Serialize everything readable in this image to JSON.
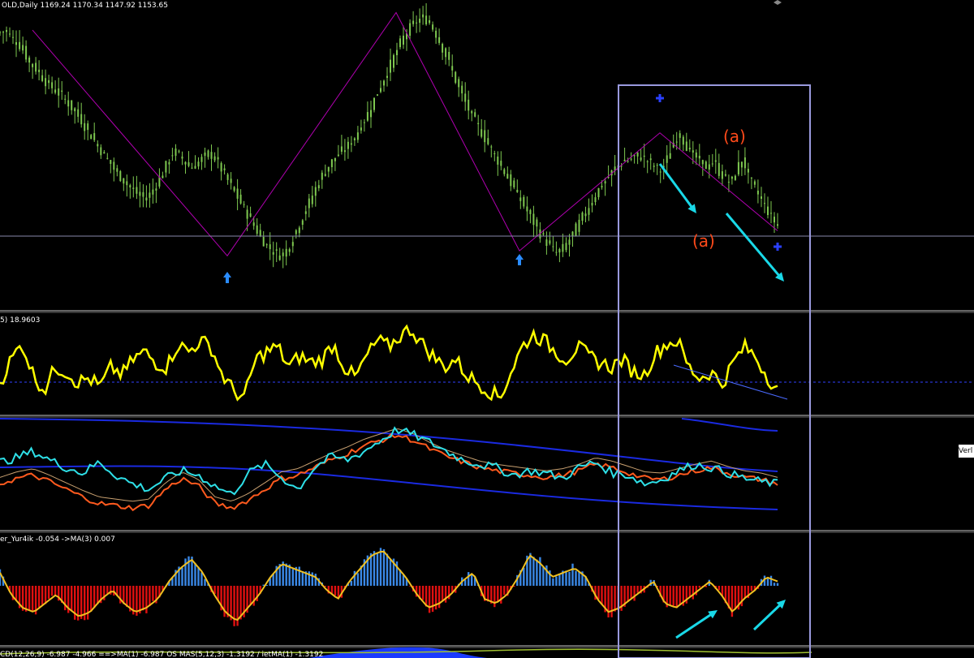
{
  "colors": {
    "background": "#000000",
    "candle": "#7ec850",
    "zigzag": "#b000b0",
    "highlight_box": "#9a9ade",
    "cyan_arrow": "#19d9e8",
    "annotation": "#ff4a1a",
    "rsi_line": "#ffff00",
    "stoch_main": "#2ee0e8",
    "stoch_signal": "#ff5a1e",
    "band": "#1a2ae0",
    "osc_pos": "#3a88e6",
    "osc_neg": "#e01010",
    "osc_ma": "#f0c020"
  },
  "header": {
    "symbol_text": "OLD,Daily  1169.24 1170.34 1147.92 1153.65",
    "rsi_text": "5) 18.9603",
    "osc_text": "er_Yur4ik -0.054  ->MA(3) 0.007",
    "macd_text": "CD(12,26,9) -6.987 -4.966  ==>MA(1)  -6.987  OS MAS(5,12,3) -1.3192 / ietMA(1) -1.3192"
  },
  "side_tag": "Verl",
  "annotations": [
    "(a)",
    "(a)"
  ],
  "chart_data": [
    {
      "type": "candlestick",
      "panel": "price",
      "title": "OLD,Daily",
      "legend": "1169.24 1170.34 1147.92 1153.65",
      "close_path": [
        1162,
        1163,
        1160,
        1158,
        1155,
        1150,
        1148,
        1145,
        1142,
        1140,
        1138,
        1136,
        1133,
        1130,
        1127,
        1123,
        1120,
        1116,
        1113,
        1110,
        1106,
        1104,
        1101,
        1099,
        1097,
        1096,
        1098,
        1102,
        1106,
        1111,
        1115,
        1113,
        1110,
        1108,
        1110,
        1112,
        1114,
        1112,
        1108,
        1104,
        1100,
        1096,
        1092,
        1088,
        1084,
        1080,
        1077,
        1075,
        1073,
        1074,
        1078,
        1083,
        1088,
        1093,
        1098,
        1103,
        1107,
        1110,
        1113,
        1115,
        1117,
        1120,
        1124,
        1128,
        1133,
        1138,
        1143,
        1148,
        1153,
        1158,
        1162,
        1165,
        1167,
        1168,
        1166,
        1162,
        1157,
        1152,
        1146,
        1140,
        1135,
        1130,
        1126,
        1122,
        1118,
        1114,
        1110,
        1106,
        1102,
        1098,
        1094,
        1090,
        1086,
        1082,
        1079,
        1076,
        1074,
        1076,
        1079,
        1083,
        1087,
        1091,
        1095,
        1099,
        1102,
        1105,
        1108,
        1110,
        1111,
        1112,
        1113,
        1112,
        1110,
        1108,
        1107,
        1112,
        1118,
        1122,
        1118,
        1114,
        1112,
        1110,
        1108,
        1111,
        1106,
        1104,
        1102,
        1108,
        1112,
        1104,
        1100,
        1096,
        1092,
        1088,
        1085
      ],
      "zigzag": [
        1163,
        1073,
        1170,
        1075,
        1122,
        1083
      ]
    },
    {
      "type": "line",
      "panel": "oscillator",
      "title": "5) 18.9603",
      "series": [
        {
          "values": [
            45,
            60,
            70,
            50,
            40,
            55,
            52,
            45,
            48,
            42,
            55,
            50,
            60,
            65,
            58,
            55,
            70,
            65,
            72,
            68,
            50,
            40,
            35,
            60,
            65,
            68,
            55,
            62,
            58,
            60,
            70,
            55,
            48,
            62,
            72,
            68,
            75,
            80,
            70,
            62,
            55,
            60,
            50,
            45,
            40,
            35,
            52,
            68,
            76,
            72,
            65,
            60,
            68,
            62,
            58,
            55,
            60,
            52,
            50,
            64,
            70,
            72,
            55,
            48,
            52,
            44,
            58,
            68,
            62,
            50,
            40
          ]
        }
      ],
      "reference_level": 50
    },
    {
      "type": "line",
      "panel": "stochastic",
      "series": [
        {
          "name": "main",
          "values": [
            60,
            64,
            70,
            62,
            55,
            50,
            60,
            48,
            40,
            35,
            45,
            52,
            48,
            38,
            30,
            50,
            58,
            46,
            35,
            55,
            65,
            62,
            70,
            80,
            90,
            85,
            78,
            70,
            62,
            58,
            55,
            48,
            52,
            50,
            45,
            55,
            60,
            50,
            48,
            40,
            44,
            52,
            58,
            55,
            50,
            45,
            42,
            40
          ]
        },
        {
          "name": "signal",
          "values": [
            40,
            45,
            48,
            42,
            35,
            28,
            22,
            20,
            18,
            20,
            35,
            45,
            38,
            22,
            18,
            25,
            35,
            45,
            48,
            55,
            62,
            68,
            75,
            80,
            85,
            80,
            72,
            65,
            60,
            55,
            52,
            50,
            48,
            46,
            48,
            52,
            58,
            55,
            50,
            45,
            44,
            48,
            52,
            55,
            50,
            46,
            44,
            40
          ]
        }
      ]
    },
    {
      "type": "bar",
      "panel": "histogram",
      "title": "er_Yur4ik",
      "legend": "-0.054  ->MA(3) 0.007",
      "values": [
        0.3,
        -0.2,
        -0.5,
        -0.6,
        -0.4,
        -0.2,
        -0.5,
        -0.7,
        -0.6,
        -0.3,
        -0.1,
        -0.4,
        -0.6,
        -0.5,
        -0.3,
        0.1,
        0.4,
        0.6,
        0.3,
        -0.2,
        -0.6,
        -0.8,
        -0.5,
        -0.2,
        0.2,
        0.5,
        0.4,
        0.3,
        0.2,
        -0.1,
        -0.3,
        0.1,
        0.4,
        0.7,
        0.8,
        0.5,
        0.2,
        -0.2,
        -0.5,
        -0.4,
        -0.2,
        0.1,
        0.3,
        -0.3,
        -0.4,
        -0.2,
        0.2,
        0.7,
        0.5,
        0.2,
        0.3,
        0.4,
        0.2,
        -0.3,
        -0.6,
        -0.5,
        -0.3,
        -0.1,
        0.1,
        -0.4,
        -0.5,
        -0.3,
        -0.1,
        0.1,
        -0.2,
        -0.6,
        -0.3,
        -0.1,
        0.2,
        0.1
      ]
    }
  ]
}
